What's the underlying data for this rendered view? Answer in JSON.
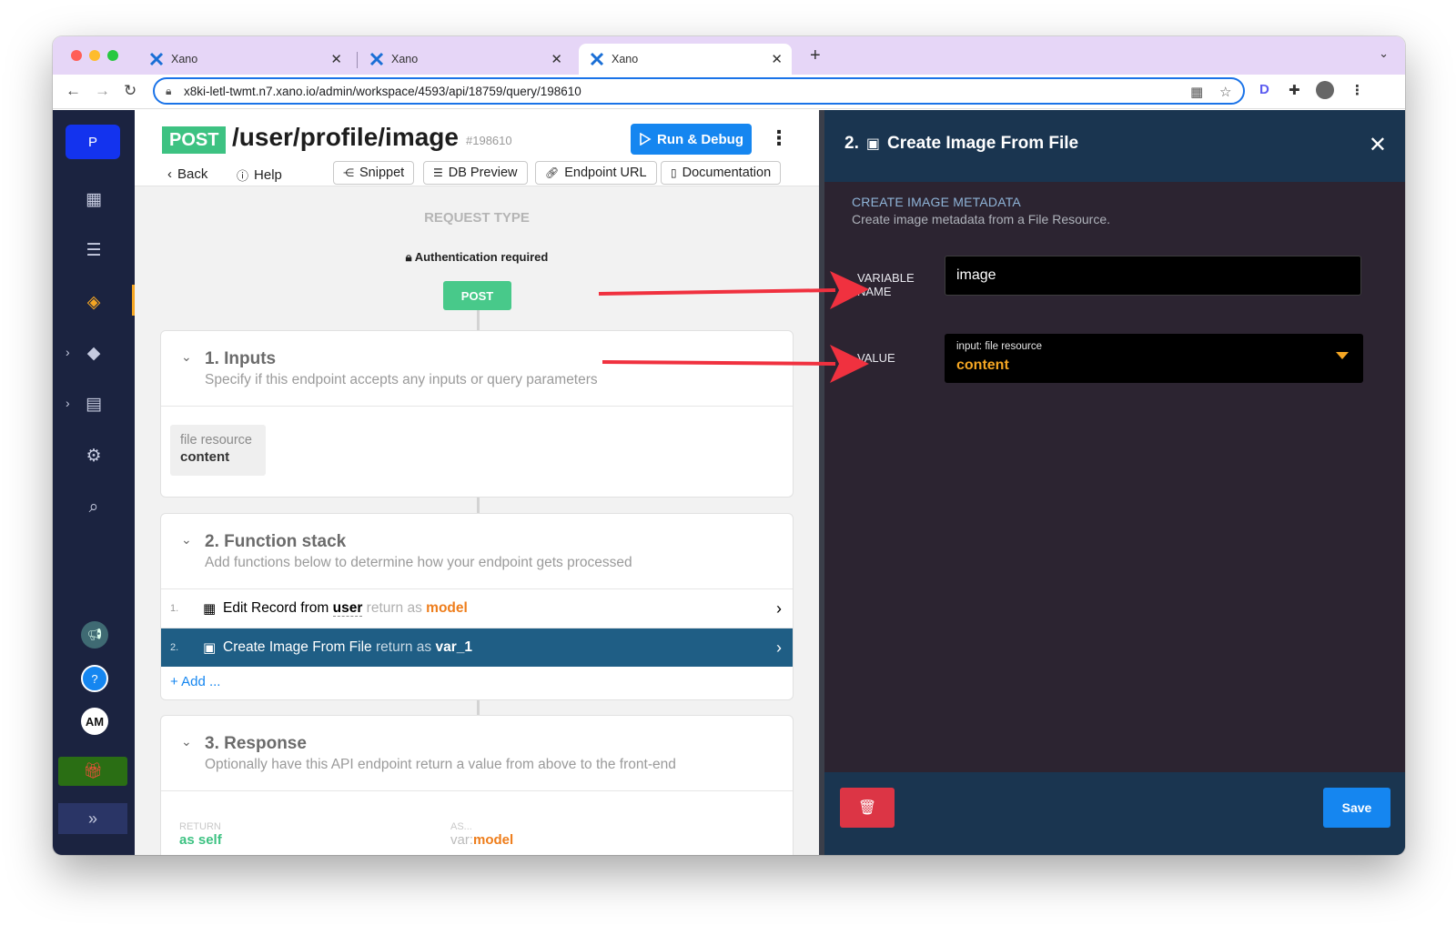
{
  "browser": {
    "tabs": [
      {
        "title": "Xano"
      },
      {
        "title": "Xano"
      },
      {
        "title": "Xano"
      }
    ],
    "url": "x8ki-letl-twmt.n7.xano.io/admin/workspace/4593/api/18759/query/198610"
  },
  "sidebar": {
    "workspace_initial": "P",
    "user_initials": "AM",
    "icons": [
      "dashboard-icon",
      "database-icon",
      "api-icon",
      "addons-icon",
      "marketplace-icon",
      "settings-icon",
      "search-icon",
      "announcement-icon",
      "help-icon",
      "gift-icon",
      "expand-icon"
    ]
  },
  "endpoint": {
    "method": "POST",
    "path": "/user/profile/image",
    "id": "#198610",
    "run_label": "Run & Debug",
    "back_label": "Back",
    "help_label": "Help",
    "snippet_label": "Snippet",
    "db_preview_label": "DB Preview",
    "endpoint_url_label": "Endpoint URL",
    "documentation_label": "Documentation"
  },
  "request": {
    "title": "REQUEST TYPE",
    "auth": "Authentication required",
    "method_pill": "POST"
  },
  "inputs": {
    "title": "1. Inputs",
    "description": "Specify if this endpoint accepts any inputs or query parameters",
    "items": [
      {
        "type": "file resource",
        "name": "content"
      }
    ]
  },
  "function_stack": {
    "title": "2. Function stack",
    "description": "Add functions below to determine how your endpoint gets processed",
    "items": [
      {
        "num": "1.",
        "name": "Edit Record from",
        "target": "user",
        "return_text": "return as",
        "var": "model"
      },
      {
        "num": "2.",
        "name": "Create Image From File",
        "return_text": "return as",
        "var": "var_1"
      }
    ],
    "add_label": "Add ..."
  },
  "response": {
    "title": "3. Response",
    "description": "Optionally have this API endpoint return a value from above to the front-end",
    "return_label": "RETURN",
    "return_value": "as self",
    "as_label": "AS...",
    "as_prefix": "var:",
    "as_value": "model"
  },
  "panel": {
    "number": "2.",
    "title": "Create Image From File",
    "meta_title": "CREATE IMAGE METADATA",
    "meta_desc": "Create image metadata from a File Resource.",
    "var_label_1": "VARIABLE",
    "var_label_2": "NAME",
    "var_value": "image",
    "value_label": "VALUE",
    "value_type": "input: file resource",
    "value_selected": "content",
    "save_label": "Save"
  },
  "colors": {
    "annotation_arrow": "#f0313f",
    "accent": "#1586f0",
    "post_green": "#3dc282",
    "panel_bg": "#2c2431",
    "panel_header": "#1a3550"
  }
}
